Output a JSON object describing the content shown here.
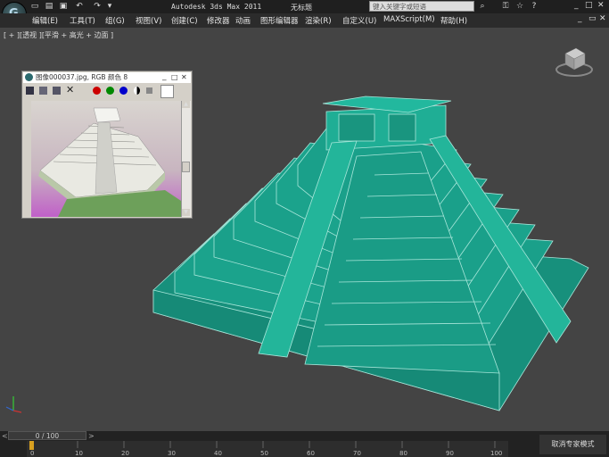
{
  "title": {
    "app": "Autodesk 3ds Max  2011",
    "file": "无标题",
    "search_placeholder": "键入关键字或短语"
  },
  "menu": [
    "编辑(E)",
    "工具(T)",
    "组(G)",
    "视图(V)",
    "创建(C)",
    "修改器",
    "动画",
    "图形编辑器",
    "渲染(R)",
    "自定义(U)",
    "MAXScript(M)",
    "帮助(H)"
  ],
  "viewport": {
    "label": "[ + ][透视 ][平滑 + 高光 + 边面 ]"
  },
  "frame_window": {
    "title": "图像000037.jpg, RGB 颜色 8"
  },
  "timeline": {
    "slider": "0 / 100",
    "ticks": [
      "0",
      "10",
      "20",
      "30",
      "40",
      "50",
      "60",
      "70",
      "80",
      "90",
      "100"
    ]
  },
  "status": {
    "button": "取消专家模式"
  },
  "colors": {
    "mesh": "#1a9e88",
    "mesh_edge": "#a8e6da",
    "bg": "#444444"
  }
}
